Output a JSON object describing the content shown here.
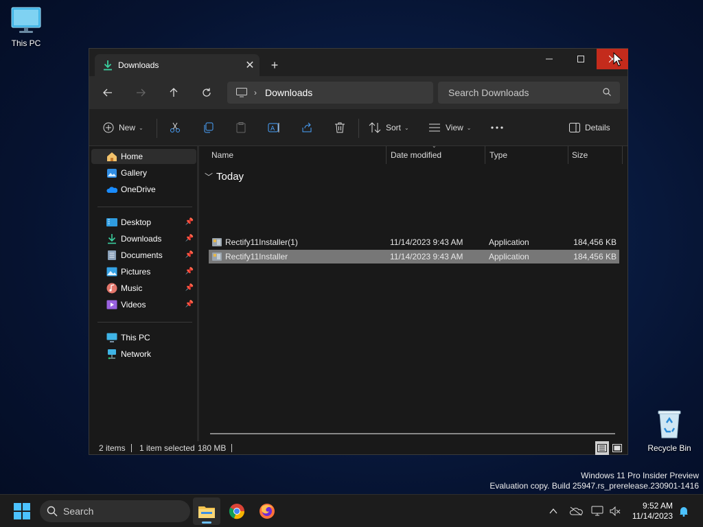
{
  "desktop": {
    "this_pc_label": "This PC",
    "recycle_bin_label": "Recycle Bin"
  },
  "window": {
    "tab_title": "Downloads",
    "address": {
      "location": "Downloads"
    },
    "search_placeholder": "Search Downloads",
    "toolbar": {
      "new_label": "New",
      "sort_label": "Sort",
      "view_label": "View",
      "details_label": "Details"
    },
    "sidebar": {
      "top_items": [
        {
          "label": "Home",
          "icon": "home-icon"
        },
        {
          "label": "Gallery",
          "icon": "gallery-icon"
        },
        {
          "label": "OneDrive",
          "icon": "onedrive-icon"
        }
      ],
      "pinned_items": [
        {
          "label": "Desktop",
          "icon": "desktop-icon"
        },
        {
          "label": "Downloads",
          "icon": "downloads-icon"
        },
        {
          "label": "Documents",
          "icon": "documents-icon"
        },
        {
          "label": "Pictures",
          "icon": "pictures-icon"
        },
        {
          "label": "Music",
          "icon": "music-icon"
        },
        {
          "label": "Videos",
          "icon": "videos-icon"
        }
      ],
      "bottom_items": [
        {
          "label": "This PC",
          "icon": "this-pc-icon"
        },
        {
          "label": "Network",
          "icon": "network-icon"
        }
      ]
    },
    "columns": {
      "name": "Name",
      "date": "Date modified",
      "type": "Type",
      "size": "Size"
    },
    "group_label": "Today",
    "files": [
      {
        "name": "Rectify11Installer(1)",
        "date": "11/14/2023 9:43 AM",
        "type": "Application",
        "size": "184,456 KB",
        "selected": false
      },
      {
        "name": "Rectify11Installer",
        "date": "11/14/2023 9:43 AM",
        "type": "Application",
        "size": "184,456 KB",
        "selected": true
      }
    ],
    "status": {
      "item_count": "2 items",
      "selected": "1 item selected",
      "selected_size": "180 MB"
    }
  },
  "watermark": {
    "line1": "Windows 11 Pro Insider Preview",
    "line2": "Evaluation copy. Build 25947.rs_prerelease.230901-1416"
  },
  "taskbar": {
    "search_label": "Search",
    "time": "9:52 AM",
    "date": "11/14/2023"
  },
  "colors": {
    "accent": "#6cc0ff",
    "close_hover": "#c42b1c",
    "selection": "#777777"
  }
}
